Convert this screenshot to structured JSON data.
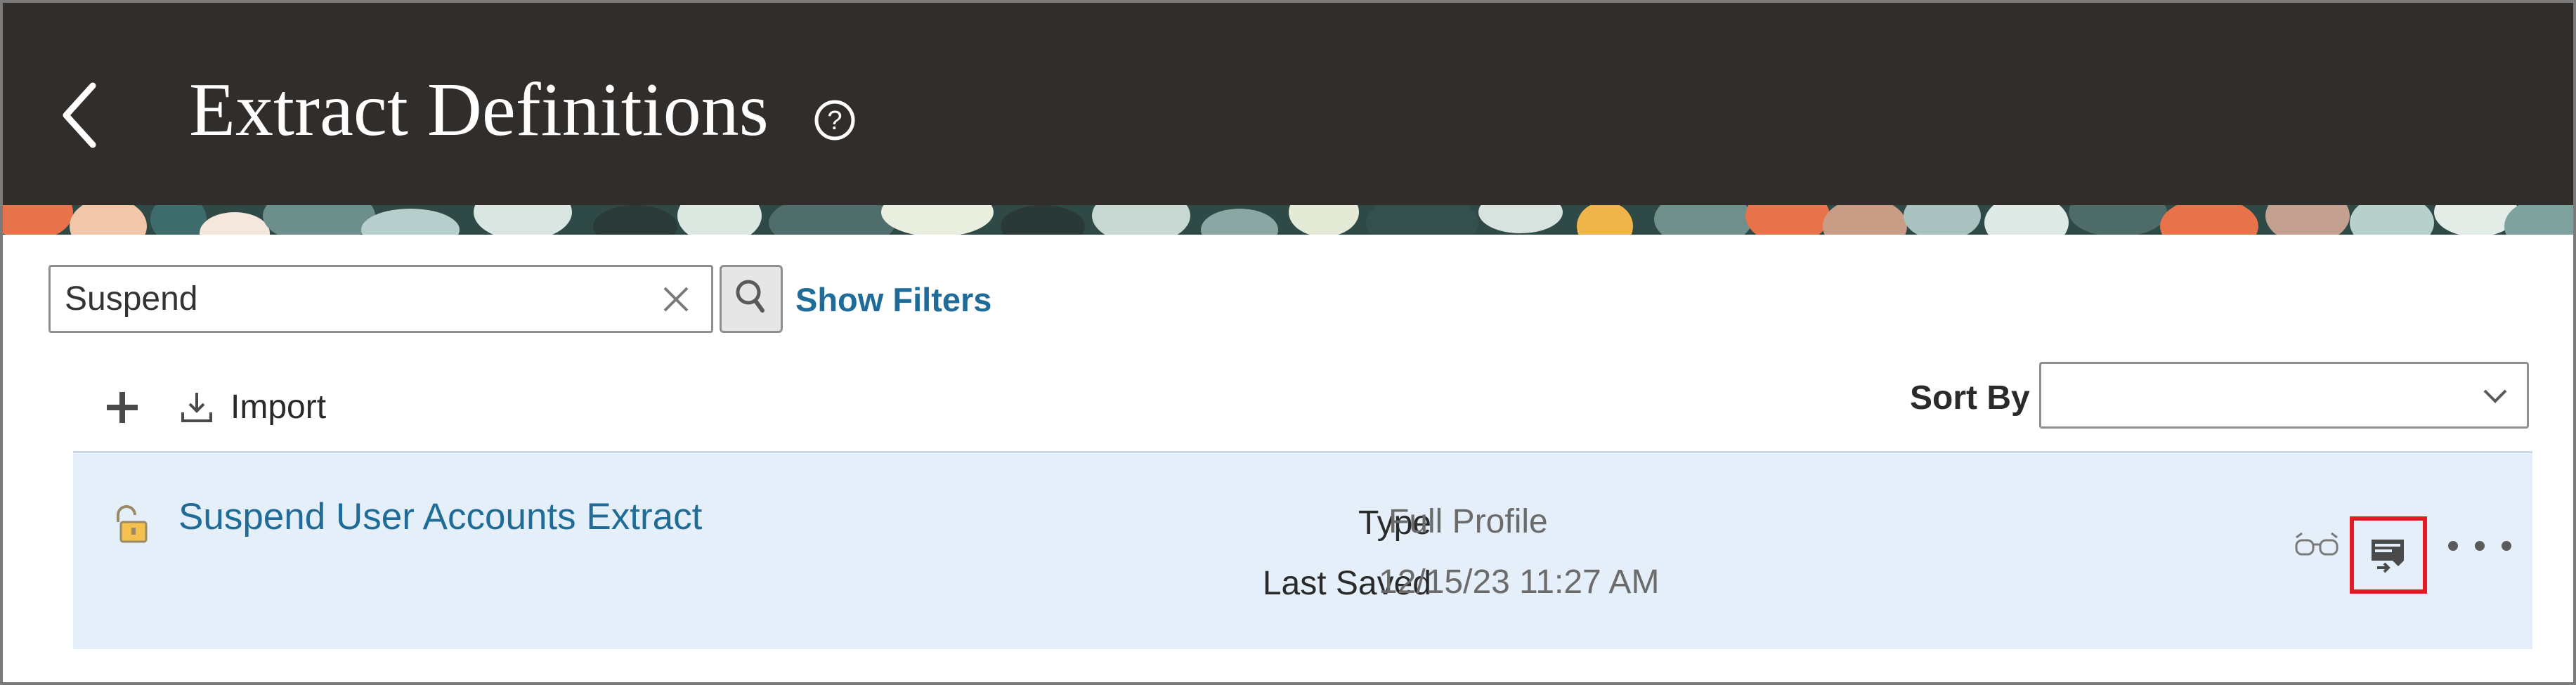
{
  "header": {
    "title": "Extract Definitions",
    "back_icon": "chevron-left-icon",
    "help_icon": "question-circle-icon",
    "background_color": "#312d2a"
  },
  "search": {
    "value": "Suspend",
    "clear_icon": "close-icon",
    "search_icon": "search-icon",
    "show_filters_label": "Show Filters"
  },
  "toolbar": {
    "add_icon": "plus-icon",
    "import_icon": "download-icon",
    "import_label": "Import",
    "sort_by_label": "Sort By",
    "sort_by_value": ""
  },
  "results": [
    {
      "title": "Suspend User Accounts Extract",
      "lock_icon": "unlocked-padlock-icon",
      "type_label": "Type",
      "type_value": "Full Profile",
      "last_saved_label": "Last Saved",
      "last_saved_value": "12/15/23 11:27 AM",
      "actions": [
        "view-icon",
        "submit-icon",
        "more-icon"
      ]
    }
  ],
  "colors": {
    "link": "#1f6c98",
    "row_background": "#e4eff9",
    "highlight": "#e21b22"
  }
}
